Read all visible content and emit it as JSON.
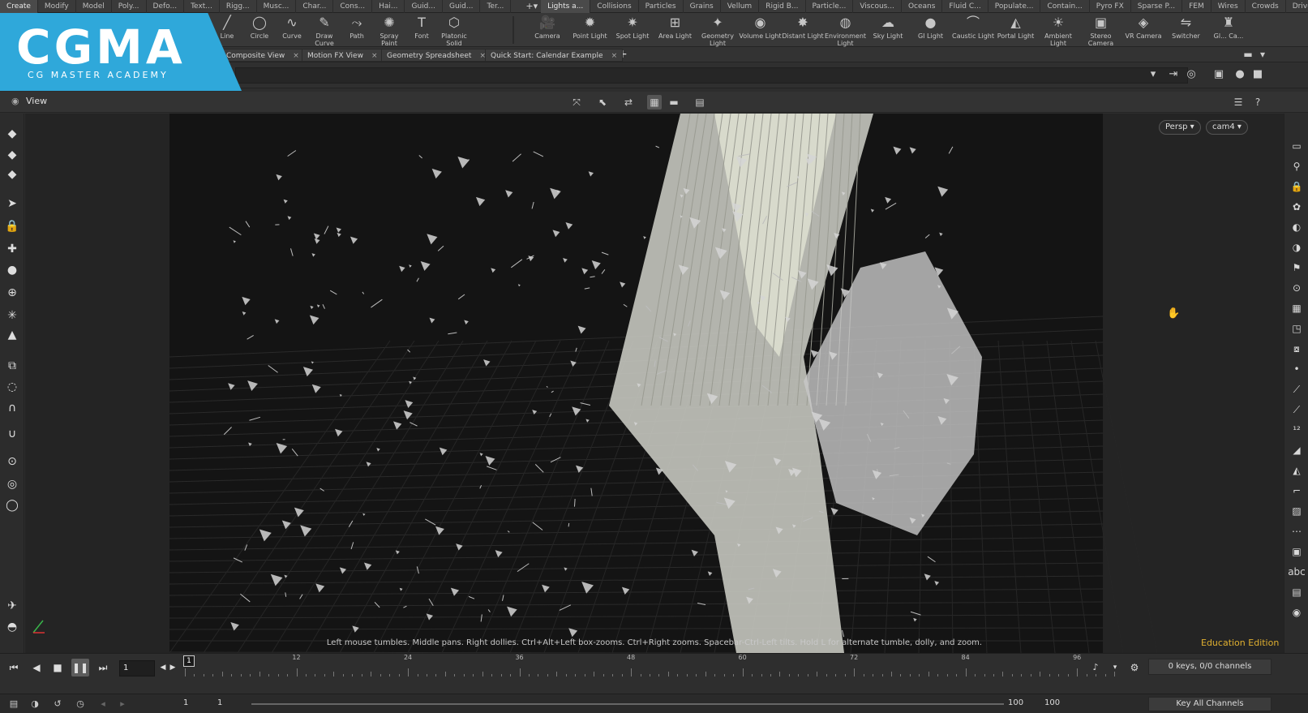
{
  "shelf_tabs_left": [
    "Create",
    "Modify",
    "Model",
    "Poly...",
    "Defo...",
    "Text...",
    "Rigg...",
    "Musc...",
    "Char...",
    "Cons...",
    "Hai...",
    "Guid...",
    "Guid...",
    "Ter..."
  ],
  "shelf_tabs_right": [
    "Lights a...",
    "Collisions",
    "Particles",
    "Grains",
    "Vellum",
    "Rigid B...",
    "Particle...",
    "Viscous...",
    "Oceans",
    "Fluid C...",
    "Populate...",
    "Contain...",
    "Pyro FX",
    "Sparse P...",
    "FEM",
    "Wires",
    "Crowds",
    "Drive Si..."
  ],
  "tools_left": [
    {
      "label": "Line",
      "icon": "line-icon"
    },
    {
      "label": "Circle",
      "icon": "circle-icon"
    },
    {
      "label": "Curve",
      "icon": "curve-icon"
    },
    {
      "label": "Draw Curve",
      "icon": "draw-curve-icon"
    },
    {
      "label": "Path",
      "icon": "path-icon"
    },
    {
      "label": "Spray Paint",
      "icon": "spray-paint-icon"
    },
    {
      "label": "Font",
      "icon": "font-icon"
    },
    {
      "label": "Platonic Solid",
      "icon": "platonic-icon"
    }
  ],
  "tools_right": [
    {
      "label": "Camera",
      "icon": "camera-icon"
    },
    {
      "label": "Point Light",
      "icon": "point-light-icon"
    },
    {
      "label": "Spot Light",
      "icon": "spot-light-icon"
    },
    {
      "label": "Area Light",
      "icon": "area-light-icon"
    },
    {
      "label": "Geometry Light",
      "icon": "geometry-light-icon"
    },
    {
      "label": "Volume Light",
      "icon": "volume-light-icon"
    },
    {
      "label": "Distant Light",
      "icon": "distant-light-icon"
    },
    {
      "label": "Environment Light",
      "icon": "environment-light-icon"
    },
    {
      "label": "Sky Light",
      "icon": "sky-light-icon"
    },
    {
      "label": "GI Light",
      "icon": "gi-light-icon"
    },
    {
      "label": "Caustic Light",
      "icon": "caustic-light-icon"
    },
    {
      "label": "Portal Light",
      "icon": "portal-light-icon"
    },
    {
      "label": "Ambient Light",
      "icon": "ambient-light-icon"
    },
    {
      "label": "Stereo Camera",
      "icon": "stereo-camera-icon"
    },
    {
      "label": "VR Camera",
      "icon": "vr-camera-icon"
    },
    {
      "label": "Switcher",
      "icon": "switcher-icon"
    },
    {
      "label": "Gl... Ca...",
      "icon": "gamepad-camera-icon"
    }
  ],
  "desktop_tabs": [
    "Composite View",
    "Motion FX View",
    "Geometry Spreadsheet",
    "Quick Start: Calendar Example"
  ],
  "logo": {
    "main": "CGMA",
    "sub": "CG MASTER ACADEMY",
    "color": "#2fa8da"
  },
  "view": {
    "title": "View",
    "persp": "Persp",
    "camera": "cam4"
  },
  "help_text": "Left mouse tumbles. Middle pans. Right dollies. Ctrl+Alt+Left box-zooms. Ctrl+Right zooms. Spacebar-Ctrl-Left tilts. Hold L for alternate tumble, dolly, and zoom.",
  "edition": "Education Edition",
  "timeline": {
    "current_frame": "1",
    "marker_frame": "1",
    "ticks": [
      "12",
      "24",
      "36",
      "48",
      "60",
      "72",
      "84",
      "96"
    ],
    "keys_info": "0 keys, 0/0 channels",
    "key_all": "Key All Channels",
    "range_start": "1",
    "range_start2": "1",
    "range_end": "100",
    "range_end2": "100"
  }
}
